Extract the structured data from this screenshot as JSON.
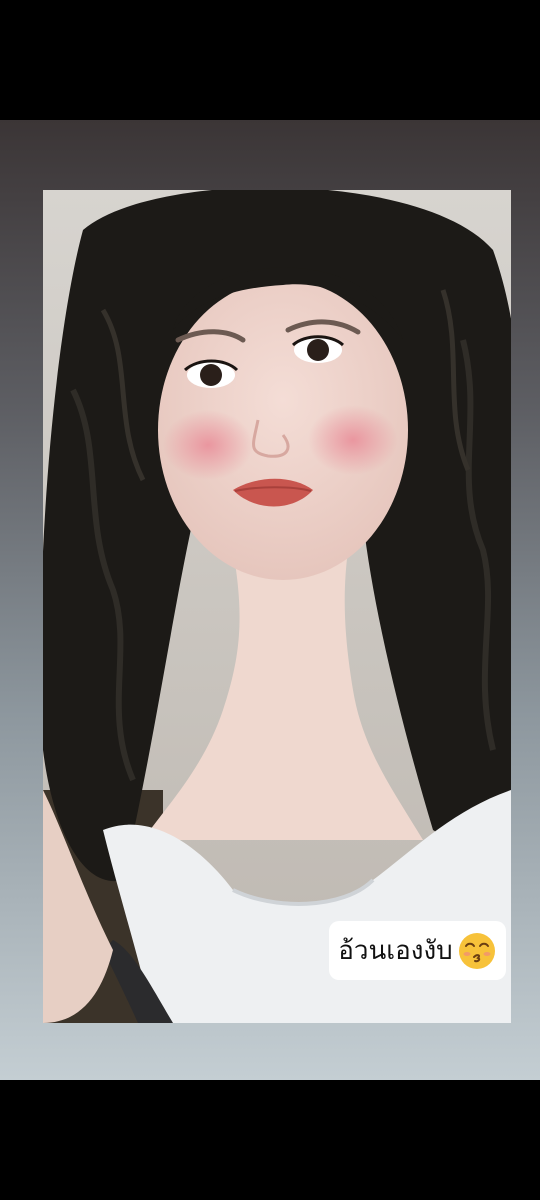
{
  "story": {
    "caption_sticker": "อ้วนเองงับ",
    "sticker_emoji": "kissing-face-with-smiling-eyes-icon"
  },
  "colors": {
    "screen_background": "#000000",
    "gradient_top": "#3b3536",
    "gradient_bottom": "#c4ced3",
    "sticker_background": "#ffffff",
    "emoji_yellow": "#f7c23a"
  }
}
